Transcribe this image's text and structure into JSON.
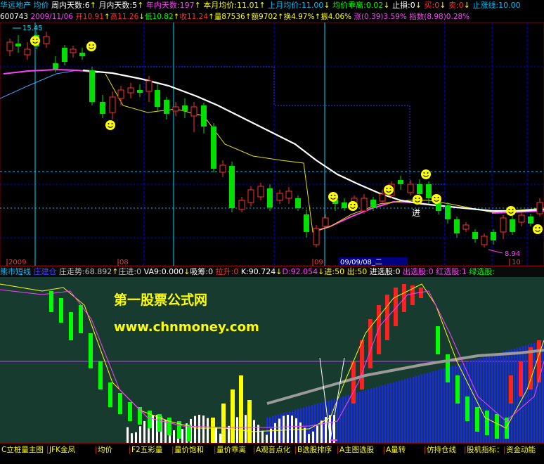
{
  "header": {
    "stock_name": "华远地产",
    "indicator": "均价",
    "week_days": "周内天数:6",
    "month_days": "月内天数:5",
    "year_days": "年内天数:197",
    "month_avg": "本月均价:11.01",
    "last_month_avg": "上月均价:11.00",
    "avg_deviation": "均价乖离:0.02",
    "stop_up": "止損:0",
    "buy": "买:0",
    "sell": "卖:0",
    "upline": "止涨线:10.00"
  },
  "quote": {
    "code": "600743",
    "date": "2009/11/06",
    "open": "开10.91",
    "high": "高11.26",
    "low": "低10.82",
    "close": "收11.24",
    "volume": "量87536",
    "amount": "额9702",
    "turnover": "换4.97%",
    "amplitude": "振4.06%",
    "change": "涨(0.39)3.59%",
    "index": "指数(8.98)0.28%"
  },
  "price_chart": {
    "high_label": "15.45",
    "low_label": "8.94",
    "buy_marker": "进",
    "x_labels": [
      "2009",
      "08",
      "09",
      "09/09/08_二",
      "10"
    ]
  },
  "indicator_bar": {
    "name": "熊市短线",
    "mode": "庄建仓",
    "trend": "庄走势:68.892",
    "zhuang_jin": "庄进:0",
    "va9": "VA9:0.000",
    "absorb": "吸筹:0",
    "pull": "拉升:0",
    "k": "K:90.724",
    "d": "D:92.054",
    "jin": "进:50",
    "chu": "出:50",
    "jin_select": "进选股:0",
    "chu_select": "出选股:0",
    "red_select": "红选股:1",
    "green_select": "绿选股:"
  },
  "watermark": {
    "title": "第一股票公式网",
    "url": "www.chnmoney.com"
  },
  "tabs": [
    "C立桩量主图",
    "JFK金凤",
    "均价",
    "F2五彩量",
    "量价饱和",
    "量价乖离",
    "A观音点化",
    "B选股排序",
    "A主图选股",
    "A量转",
    "仿持仓线",
    "股机指标：",
    "资金动能"
  ],
  "colors": {
    "bull": "#ff3b3b",
    "bear": "#00e000",
    "avg_line": "#ffffff",
    "ma_line": "#ff40ff",
    "yellow": "#ffff00",
    "cyan": "#00d8ff",
    "blue_grid": "#2a3cff"
  }
}
